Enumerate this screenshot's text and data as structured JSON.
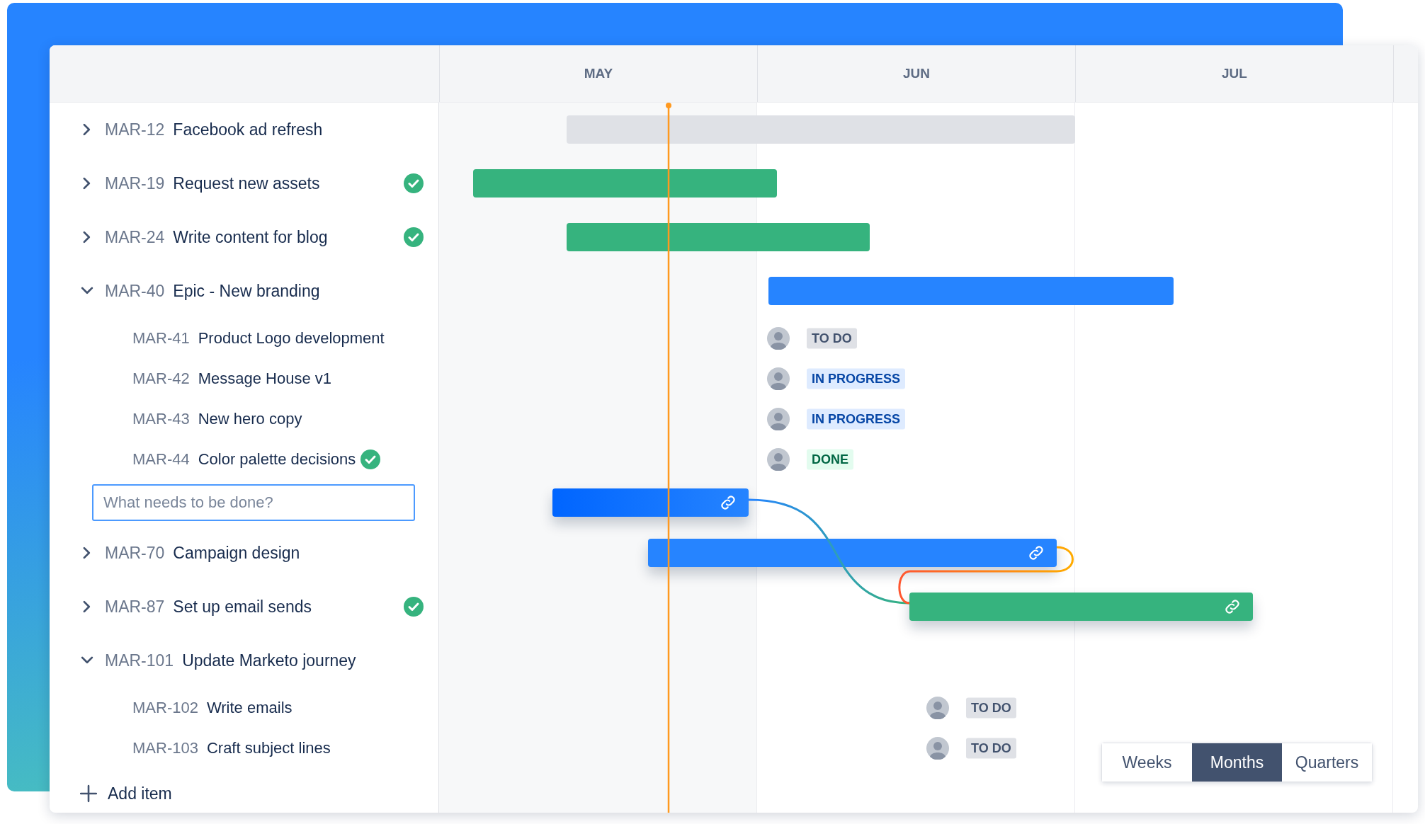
{
  "timeline": {
    "months": [
      "MAY",
      "JUN",
      "JUL"
    ]
  },
  "rows": [
    {
      "kind": "task",
      "id": "MAR-12",
      "title": "Facebook ad refresh",
      "expanded": false,
      "done": false,
      "color": "#dfe1e6",
      "linked": false
    },
    {
      "kind": "task",
      "id": "MAR-19",
      "title": "Request new assets",
      "expanded": false,
      "done": true,
      "color": "#36b37e",
      "linked": false
    },
    {
      "kind": "task",
      "id": "MAR-24",
      "title": "Write content for blog",
      "expanded": false,
      "done": true,
      "color": "#36b37e",
      "linked": false
    },
    {
      "kind": "task",
      "id": "MAR-40",
      "title": "Epic - New branding",
      "expanded": true,
      "done": false,
      "color": "#2684ff",
      "linked": false
    },
    {
      "kind": "subtask",
      "id": "MAR-41",
      "title": "Product Logo development",
      "done": false,
      "status": {
        "label": "TO DO",
        "kind": "todo"
      }
    },
    {
      "kind": "subtask",
      "id": "MAR-42",
      "title": "Message House v1",
      "done": false,
      "status": {
        "label": "IN PROGRESS",
        "kind": "inprogress"
      }
    },
    {
      "kind": "subtask",
      "id": "MAR-43",
      "title": "New hero copy",
      "done": false,
      "status": {
        "label": "IN PROGRESS",
        "kind": "inprogress"
      }
    },
    {
      "kind": "subtask",
      "id": "MAR-44",
      "title": "Color palette decisions",
      "done": true,
      "status": {
        "label": "DONE",
        "kind": "done"
      }
    },
    {
      "kind": "input",
      "placeholder": "What needs to be done?",
      "color": "#0065ff",
      "linked": true
    },
    {
      "kind": "task",
      "id": "MAR-70",
      "title": "Campaign design",
      "expanded": false,
      "done": false,
      "color": "#2684ff",
      "linked": true
    },
    {
      "kind": "task",
      "id": "MAR-87",
      "title": "Set up email sends",
      "expanded": false,
      "done": true,
      "color": "#36b37e",
      "linked": true
    },
    {
      "kind": "task",
      "id": "MAR-101",
      "title": "Update Marketo journey",
      "expanded": true,
      "done": false,
      "color": null,
      "linked": false
    },
    {
      "kind": "subtask",
      "id": "MAR-102",
      "title": "Write emails",
      "done": false,
      "status": {
        "label": "TO DO",
        "kind": "todo"
      }
    },
    {
      "kind": "subtask",
      "id": "MAR-103",
      "title": "Craft subject lines",
      "done": false,
      "status": {
        "label": "TO DO",
        "kind": "todo"
      }
    },
    {
      "kind": "add",
      "label": "Add item"
    }
  ],
  "view_switcher": [
    {
      "label": "Weeks",
      "selected": false
    },
    {
      "label": "Months",
      "selected": true
    },
    {
      "label": "Quarters",
      "selected": false
    }
  ]
}
